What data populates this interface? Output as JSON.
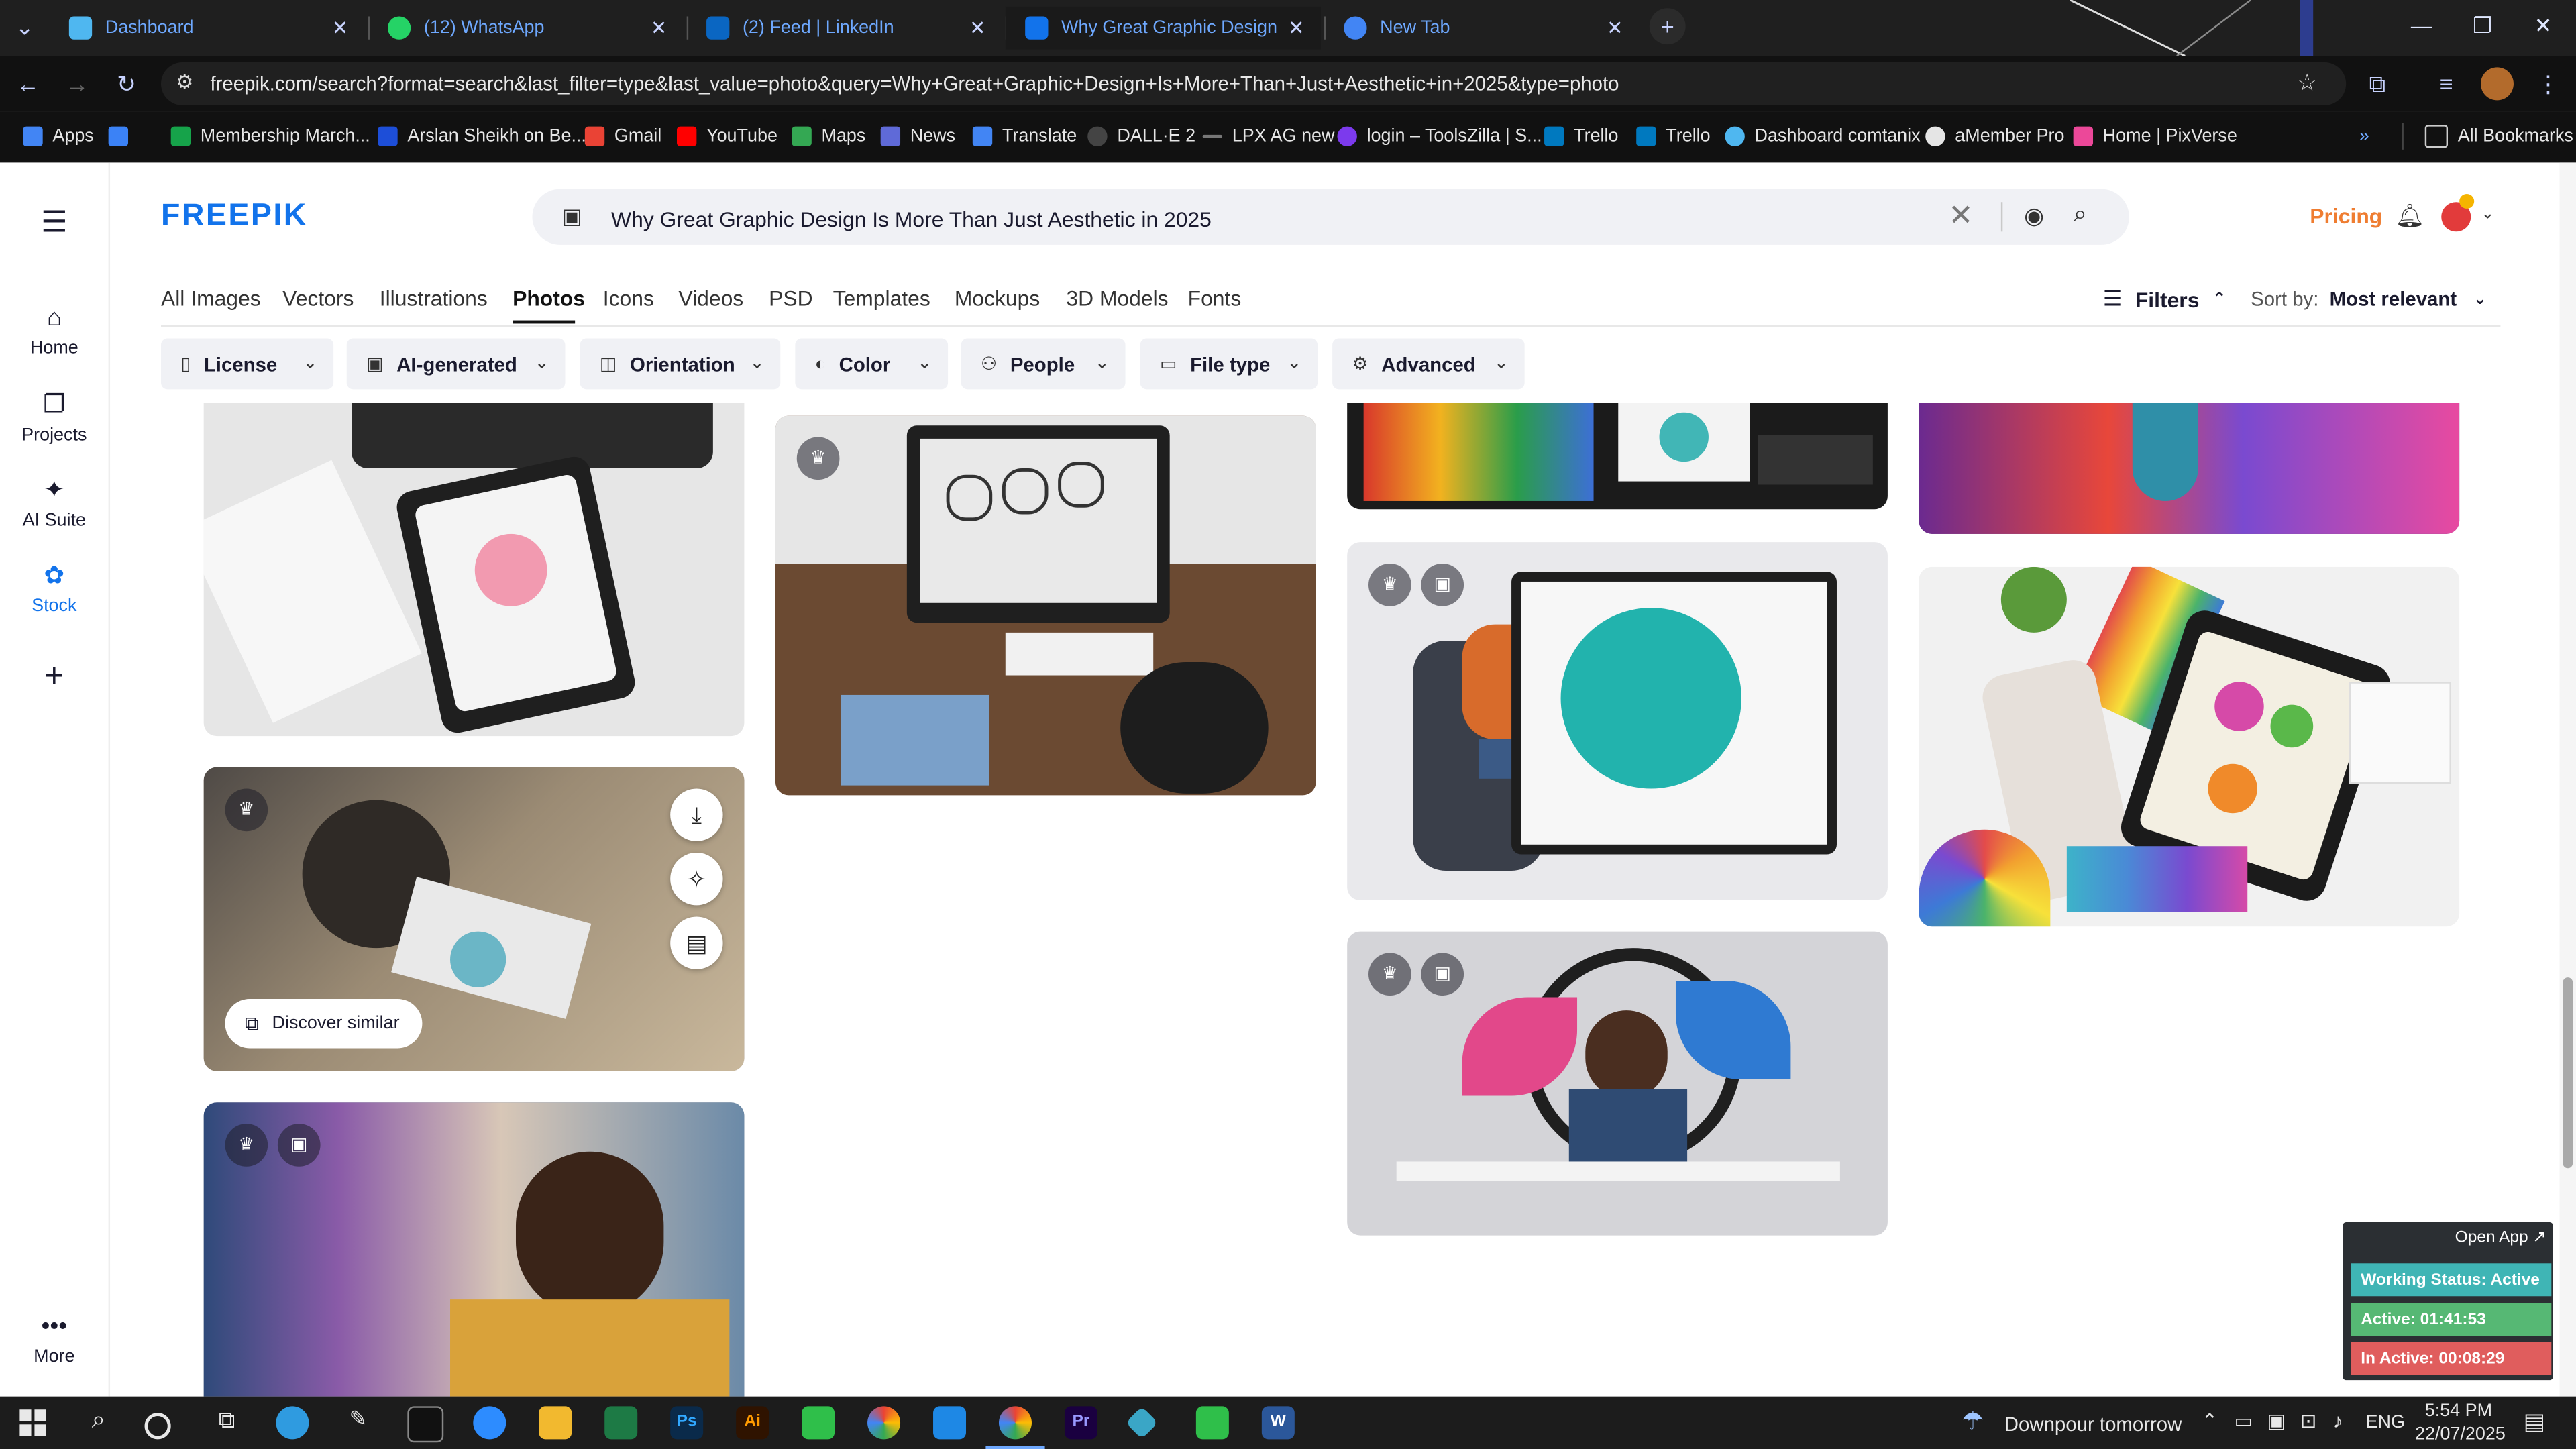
{
  "browser": {
    "tabs": [
      {
        "title": "Dashboard",
        "color": "#4fb7f0",
        "active": false
      },
      {
        "title": "(12) WhatsApp",
        "color": "#25d366",
        "active": false
      },
      {
        "title": "(2) Feed | LinkedIn",
        "color": "#0a66c2",
        "active": false
      },
      {
        "title": "Why Great Graphic Design Is M",
        "color": "#1273eb",
        "active": true
      },
      {
        "title": "New Tab",
        "color": "#4285f4",
        "active": false
      }
    ],
    "url": "freepik.com/search?format=search&last_filter=type&last_value=photo&query=Why+Great+Graphic+Design+Is+More+Than+Just+Aesthetic+in+2025&type=photo",
    "bookmarks": [
      {
        "label": "Apps",
        "color": "#4285f4"
      },
      {
        "label": "",
        "color": "#3b82f6"
      },
      {
        "label": "Membership March...",
        "color": "#16a34a"
      },
      {
        "label": "Arslan Sheikh on Be...",
        "color": "#1d4ed8"
      },
      {
        "label": "Gmail",
        "color": "#ea4335"
      },
      {
        "label": "YouTube",
        "color": "#ff0000"
      },
      {
        "label": "Maps",
        "color": "#34a853"
      },
      {
        "label": "News",
        "color": "#5f6ad8"
      },
      {
        "label": "Translate",
        "color": "#4285f4"
      },
      {
        "label": "DALL·E 2",
        "color": "#444444"
      },
      {
        "label": "LPX AG new",
        "color": "#777777"
      },
      {
        "label": "login – ToolsZilla | S...",
        "color": "#7c3aed"
      },
      {
        "label": "Trello",
        "color": "#0079bf"
      },
      {
        "label": "Trello",
        "color": "#0079bf"
      },
      {
        "label": "Dashboard comtanix",
        "color": "#4fb7f0"
      },
      {
        "label": "aMember Pro",
        "color": "#e5e5e5"
      },
      {
        "label": "Home | PixVerse",
        "color": "#ec4899"
      }
    ],
    "all_bookmarks": "All Bookmarks"
  },
  "site": {
    "logo": "FREEPIK",
    "search_value": "Why Great Graphic Design Is More Than Just Aesthetic in 2025",
    "pricing": "Pricing",
    "left_nav": [
      {
        "label": "Home",
        "icon": "home-icon",
        "glyph": "⌂"
      },
      {
        "label": "Projects",
        "icon": "projects-icon",
        "glyph": "❐"
      },
      {
        "label": "AI Suite",
        "icon": "sparkle-icon",
        "glyph": "✦"
      },
      {
        "label": "Stock",
        "icon": "stock-icon",
        "glyph": "✿"
      },
      {
        "label": "",
        "icon": "plus-icon",
        "glyph": "+"
      },
      {
        "label": "More",
        "icon": "more-icon",
        "glyph": "•••"
      }
    ],
    "categories": [
      "All Images",
      "Vectors",
      "Illustrations",
      "Photos",
      "Icons",
      "Videos",
      "PSD",
      "Templates",
      "Mockups",
      "3D Models",
      "Fonts"
    ],
    "active_category": "Photos",
    "filters_label": "Filters",
    "sort_label": "Sort by:",
    "sort_value": "Most relevant",
    "chips": [
      {
        "label": "License",
        "icon": "license-icon"
      },
      {
        "label": "AI-generated",
        "icon": "ai-icon"
      },
      {
        "label": "Orientation",
        "icon": "orientation-icon"
      },
      {
        "label": "Color",
        "icon": "palette-icon"
      },
      {
        "label": "People",
        "icon": "people-icon"
      },
      {
        "label": "File type",
        "icon": "file-icon"
      },
      {
        "label": "Advanced",
        "icon": "gear-icon"
      }
    ],
    "discover_similar": "Discover similar"
  },
  "widget": {
    "open_app": "Open App ↗",
    "status": "Working Status: Active",
    "active": "Active: 01:41:53",
    "inactive": "In Active: 00:08:29"
  },
  "taskbar": {
    "weather": "Downpour tomorrow",
    "lang": "ENG",
    "time": "5:54 PM",
    "date": "22/07/2025"
  }
}
